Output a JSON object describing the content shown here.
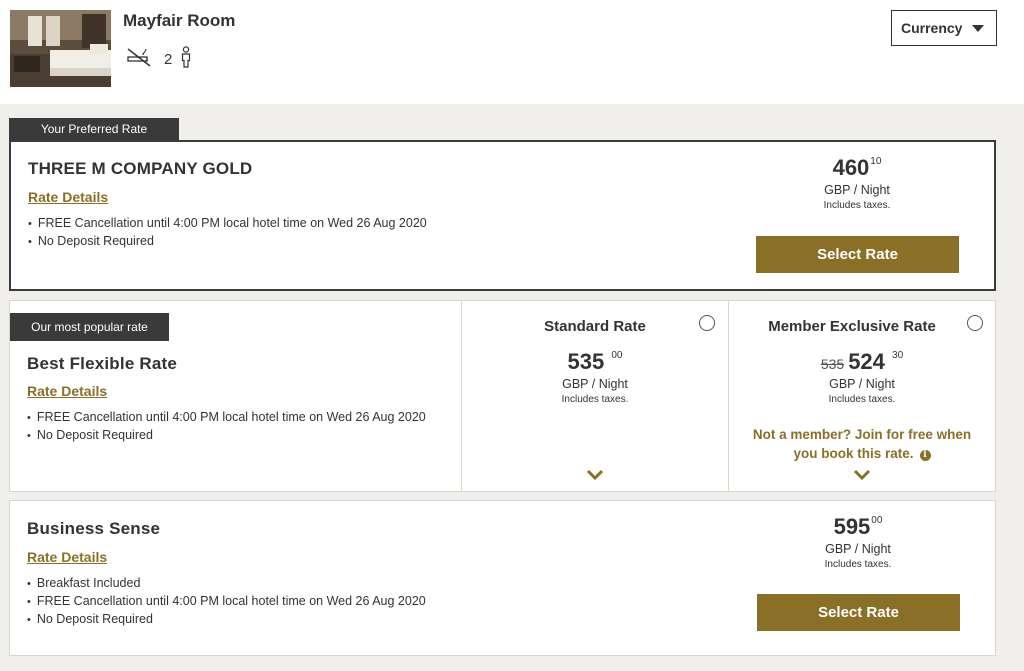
{
  "room": {
    "title": "Mayfair Room",
    "guests": "2",
    "photo": "room-photo",
    "no_smoking_icon": "no-smoking-icon",
    "person_icon": "person-icon"
  },
  "currency": {
    "label": "Currency"
  },
  "preferred": {
    "tag": "Your Preferred Rate",
    "name": "THREE M COMPANY GOLD",
    "details_link": "Rate Details",
    "bullets": [
      "FREE Cancellation until 4:00 PM local hotel time on Wed 26 Aug 2020",
      "No Deposit Required"
    ],
    "price": "460",
    "cents": "10",
    "unit": "GBP / Night",
    "tax": "Includes taxes.",
    "button": "Select Rate"
  },
  "popular": {
    "tag": "Our most popular rate",
    "name": "Best Flexible Rate",
    "details_link": "Rate Details",
    "bullets": [
      "FREE Cancellation until 4:00 PM local hotel time on Wed 26 Aug 2020",
      "No Deposit Required"
    ],
    "standard": {
      "title": "Standard Rate",
      "price": "535",
      "cents": "00",
      "unit": "GBP / Night",
      "tax": "Includes taxes."
    },
    "member": {
      "title": "Member Exclusive Rate",
      "old_price": "535",
      "price": "524",
      "cents": "30",
      "unit": "GBP / Night",
      "tax": "Includes taxes.",
      "note_line1": "Not a member? Join for free when",
      "note_line2": "you book this rate.",
      "info_icon_glyph": "i"
    }
  },
  "business": {
    "name": "Business Sense",
    "details_link": "Rate Details",
    "bullets": [
      "Breakfast Included",
      "FREE Cancellation until 4:00 PM local hotel time on Wed 26 Aug 2020",
      "No Deposit Required"
    ],
    "price": "595",
    "cents": "00",
    "unit": "GBP / Night",
    "tax": "Includes taxes.",
    "button": "Select Rate"
  },
  "colors": {
    "accent": "#8a7026",
    "dark": "#3a3a3a",
    "background": "#f1efeb"
  }
}
